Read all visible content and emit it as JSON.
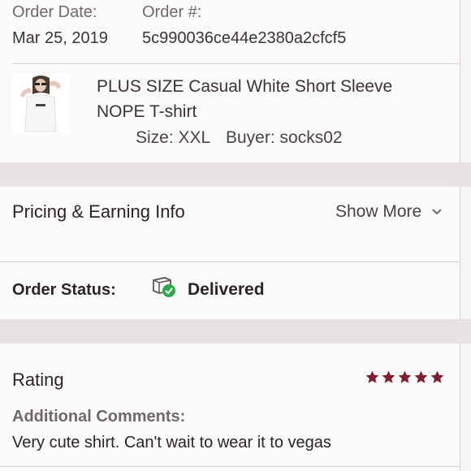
{
  "order": {
    "date_label": "Order Date:",
    "date_value": "Mar 25, 2019",
    "number_label": "Order #:",
    "number_value": "5c990036ce44e2380a2cfcf5"
  },
  "item": {
    "title_line1": "PLUS SIZE Casual White Short Sleeve",
    "title_line2": "NOPE T-shirt",
    "size_text": "Size: XXL",
    "buyer_text": "Buyer: socks02"
  },
  "pricing": {
    "title": "Pricing & Earning Info",
    "show_more": "Show More"
  },
  "status": {
    "label": "Order Status:",
    "value": "Delivered",
    "icon": "package-delivered-icon",
    "status_color": "#2fa84f"
  },
  "rating": {
    "title": "Rating",
    "stars": 5,
    "max_stars": 5,
    "star_color": "#7e1f2f",
    "comments_label": "Additional Comments:",
    "comment_text": "Very cute shirt. Can't wait to wear it to vegas"
  }
}
